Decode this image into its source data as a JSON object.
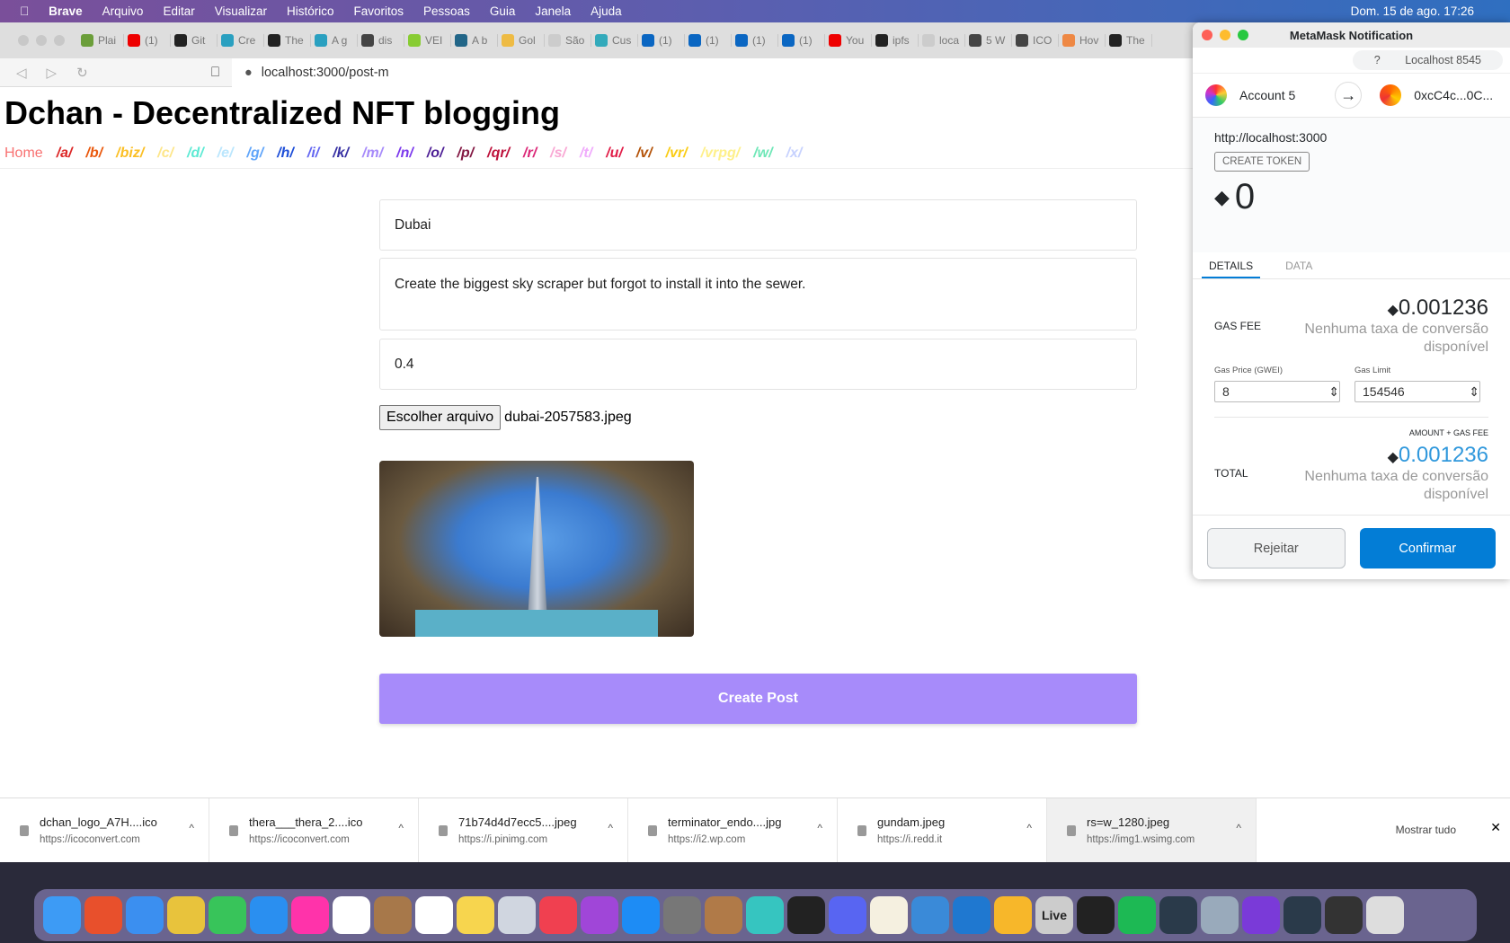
{
  "menubar": {
    "app": "Brave",
    "items": [
      "Arquivo",
      "Editar",
      "Visualizar",
      "Histórico",
      "Favoritos",
      "Pessoas",
      "Guia",
      "Janela",
      "Ajuda"
    ],
    "clock": "Dom. 15 de ago.  17:26"
  },
  "tabs": [
    {
      "label": "Plai",
      "color": "#6b9e3a"
    },
    {
      "label": "(1)",
      "color": "#e00"
    },
    {
      "label": "Git",
      "color": "#222"
    },
    {
      "label": "Cre",
      "color": "#2aa0c0"
    },
    {
      "label": "The",
      "color": "#222"
    },
    {
      "label": "A g",
      "color": "#2aa0c0"
    },
    {
      "label": "dis",
      "color": "#444"
    },
    {
      "label": "VEI",
      "color": "#8c3"
    },
    {
      "label": "A b",
      "color": "#268"
    },
    {
      "label": "Gol",
      "color": "#eb4"
    },
    {
      "label": "São",
      "color": "#ccc"
    },
    {
      "label": "Cus",
      "color": "#3ab"
    },
    {
      "label": "(1)",
      "color": "#0a66c2"
    },
    {
      "label": "(1)",
      "color": "#0a66c2"
    },
    {
      "label": "(1)",
      "color": "#0a66c2"
    },
    {
      "label": "(1)",
      "color": "#0a66c2"
    },
    {
      "label": "You",
      "color": "#e00"
    },
    {
      "label": "ipfs",
      "color": "#222"
    },
    {
      "label": "loca",
      "color": "#ccc"
    },
    {
      "label": "5 W",
      "color": "#444"
    },
    {
      "label": "ICO",
      "color": "#444"
    },
    {
      "label": "Hov",
      "color": "#e84"
    },
    {
      "label": "The",
      "color": "#222"
    }
  ],
  "address": {
    "url": "localhost:3000/post-m"
  },
  "page": {
    "title": "Dchan - Decentralized NFT blogging",
    "boards": [
      {
        "label": "Home",
        "color": "#f87171"
      },
      {
        "label": "/a/",
        "color": "#dc2626"
      },
      {
        "label": "/b/",
        "color": "#ea580c"
      },
      {
        "label": "/biz/",
        "color": "#fbbf24"
      },
      {
        "label": "/c/",
        "color": "#fde68a"
      },
      {
        "label": "/d/",
        "color": "#5eead4"
      },
      {
        "label": "/e/",
        "color": "#bae6fd"
      },
      {
        "label": "/g/",
        "color": "#60a5fa"
      },
      {
        "label": "/h/",
        "color": "#1d4ed8"
      },
      {
        "label": "/i/",
        "color": "#6366f1"
      },
      {
        "label": "/k/",
        "color": "#3730a3"
      },
      {
        "label": "/m/",
        "color": "#a78bfa"
      },
      {
        "label": "/n/",
        "color": "#7c3aed"
      },
      {
        "label": "/o/",
        "color": "#4c1d95"
      },
      {
        "label": "/p/",
        "color": "#831843"
      },
      {
        "label": "/qr/",
        "color": "#be123c"
      },
      {
        "label": "/r/",
        "color": "#db2777"
      },
      {
        "label": "/s/",
        "color": "#f9a8d4"
      },
      {
        "label": "/t/",
        "color": "#f0abfc"
      },
      {
        "label": "/u/",
        "color": "#e11d48"
      },
      {
        "label": "/v/",
        "color": "#b45309"
      },
      {
        "label": "/vr/",
        "color": "#facc15"
      },
      {
        "label": "/vrpg/",
        "color": "#fef08a"
      },
      {
        "label": "/w/",
        "color": "#6ee7b7"
      },
      {
        "label": "/x/",
        "color": "#c7d2fe"
      }
    ],
    "form": {
      "title_value": "Dubai",
      "body_value": "Create the biggest sky scraper but forgot to install it into the sewer.",
      "price_value": "0.4",
      "file_button": "Escolher arquivo",
      "file_name": "dubai-2057583.jpeg",
      "submit": "Create Post",
      "accent": "#a78bfa"
    }
  },
  "metamask": {
    "window_title": "MetaMask Notification",
    "network": "Localhost 8545",
    "from": "Account 5",
    "to": "0xcC4c...0C...",
    "origin": "http://localhost:3000",
    "method": "CREATE TOKEN",
    "value": "0",
    "tabs": [
      "DETAILS",
      "DATA"
    ],
    "gas_fee_label": "GAS FEE",
    "gas_fee": "0.001236",
    "no_conversion": "Nenhuma taxa de conversão disponível",
    "gas_price_label": "Gas Price (GWEI)",
    "gas_price": "8",
    "gas_limit_label": "Gas Limit",
    "gas_limit": "154546",
    "amount_gas_label": "AMOUNT + GAS FEE",
    "total_label": "TOTAL",
    "total": "0.001236",
    "reject": "Rejeitar",
    "confirm": "Confirmar",
    "confirm_color": "#037dd6"
  },
  "downloads": {
    "items": [
      {
        "name": "dchan_logo_A7H....ico",
        "url": "https://icoconvert.com"
      },
      {
        "name": "thera___thera_2....ico",
        "url": "https://icoconvert.com"
      },
      {
        "name": "71b74d4d7ecc5....jpeg",
        "url": "https://i.pinimg.com"
      },
      {
        "name": "terminator_endo....jpg",
        "url": "https://i2.wp.com"
      },
      {
        "name": "gundam.jpeg",
        "url": "https://i.redd.it"
      },
      {
        "name": "rs=w_1280.jpeg",
        "url": "https://img1.wsimg.com"
      }
    ],
    "show_all": "Mostrar tudo"
  },
  "dock": {
    "apps": [
      "Finder",
      "Brave",
      "Safari",
      "Chrome",
      "Messages",
      "Mail",
      "Photos",
      "Calendar",
      "Contacts",
      "Reminders",
      "Notes",
      "Launchpad",
      "Music",
      "Podcasts",
      "App Store",
      "System Preferences",
      "Archive",
      "Cube",
      "Terminal",
      "Discord",
      "Pages",
      "Keynote",
      "VS Code",
      "Sketch",
      "Live",
      "Unity",
      "Spotify",
      "League of Legends",
      "Preview",
      "GitHub Desktop",
      "League of Legends",
      "Screenshot",
      "Trash"
    ],
    "colors": [
      "#3d9bf5",
      "#e8502c",
      "#3b8ff0",
      "#e8c33c",
      "#38c45a",
      "#2a8ff0",
      "#f3a",
      "#fff",
      "#a7784a",
      "#fff",
      "#f7d54e",
      "#d0d6e0",
      "#f04050",
      "#a046d8",
      "#1d8cf5",
      "#777",
      "#b07a48",
      "#36c5c0",
      "#222",
      "#5865f2",
      "#f5f0e0",
      "#3a8ad8",
      "#1f78d0",
      "#f7b72a",
      "#ccc",
      "#222",
      "#1db954",
      "#2a3a4a",
      "#9ab",
      "#7a3ad8",
      "#2a3a4a",
      "#333",
      "#ddd"
    ]
  }
}
